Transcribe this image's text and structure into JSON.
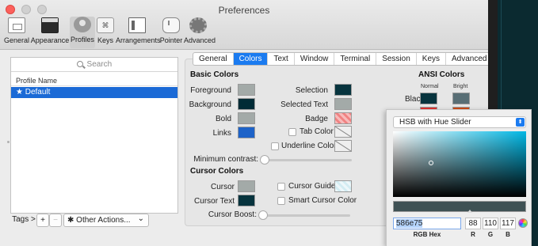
{
  "window": {
    "title": "Preferences"
  },
  "toolbar": {
    "items": [
      {
        "label": "General"
      },
      {
        "label": "Appearance"
      },
      {
        "label": "Profiles",
        "selected": true
      },
      {
        "label": "Keys"
      },
      {
        "label": "Arrangements"
      },
      {
        "label": "Pointer"
      },
      {
        "label": "Advanced"
      }
    ]
  },
  "profiles": {
    "search_placeholder": "Search",
    "column_header": "Profile Name",
    "items": [
      {
        "name": "★ Default",
        "selected": true
      }
    ],
    "bottom": {
      "tags": "Tags >",
      "add": "+",
      "remove": "−",
      "other_actions": "Other Actions...",
      "gear": "✱",
      "chevron": "⌄"
    }
  },
  "tabs": [
    {
      "label": "General"
    },
    {
      "label": "Colors",
      "active": true
    },
    {
      "label": "Text"
    },
    {
      "label": "Window"
    },
    {
      "label": "Terminal"
    },
    {
      "label": "Session"
    },
    {
      "label": "Keys"
    },
    {
      "label": "Advanced"
    }
  ],
  "colors": {
    "basic_title": "Basic Colors",
    "foreground": {
      "label": "Foreground",
      "color": "#a3aaa8"
    },
    "background": {
      "label": "Background",
      "color": "#002b36"
    },
    "bold": {
      "label": "Bold",
      "color": "#a3aaa8"
    },
    "links": {
      "label": "Links",
      "color": "#1e63c8"
    },
    "selection": {
      "label": "Selection",
      "color": "#07343e"
    },
    "selected_text": {
      "label": "Selected Text",
      "color": "#a3aaa8"
    },
    "badge": {
      "label": "Badge",
      "color": "#f08282"
    },
    "tab_color": {
      "label": "Tab Color"
    },
    "underline_color": {
      "label": "Underline Color"
    },
    "minimum_contrast": {
      "label": "Minimum contrast:",
      "value": 0
    },
    "cursor_title": "Cursor Colors",
    "cursor": {
      "label": "Cursor",
      "color": "#a3aaa8"
    },
    "cursor_text": {
      "label": "Cursor Text",
      "color": "#07343e"
    },
    "cursor_guide": {
      "label": "Cursor Guide",
      "color": "#d3ecf2"
    },
    "smart_cursor": {
      "label": "Smart Cursor Color"
    },
    "cursor_boost": {
      "label": "Cursor Boost:",
      "value": 0
    },
    "ansi_title": "ANSI Colors",
    "ansi_normal": "Normal",
    "ansi_bright": "Bright",
    "black": {
      "label": "Black",
      "normal": "#07343e",
      "bright": "#586e75"
    },
    "partial_label": "N"
  },
  "picker": {
    "mode": "HSB with Hue Slider",
    "hex": "586e75",
    "r": "88",
    "g": "110",
    "b": "117",
    "labels": {
      "hex": "RGB Hex",
      "r": "R",
      "g": "G",
      "b": "B"
    }
  }
}
